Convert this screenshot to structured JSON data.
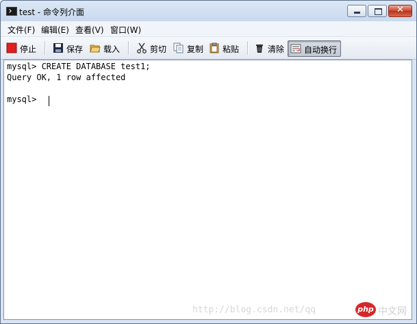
{
  "window": {
    "title": "test - 命令列介面"
  },
  "menu": {
    "items": [
      {
        "label": "文件(F)"
      },
      {
        "label": "编辑(E)"
      },
      {
        "label": "查看(V)"
      },
      {
        "label": "窗口(W)"
      }
    ]
  },
  "toolbar": {
    "stop_label": "停止",
    "save_label": "保存",
    "load_label": "载入",
    "cut_label": "剪切",
    "copy_label": "复制",
    "paste_label": "粘贴",
    "clear_label": "清除",
    "wrap_label": "自动换行"
  },
  "console": {
    "lines": [
      "mysql> CREATE DATABASE test1;",
      "Query OK, 1 row affected",
      "",
      "mysql> "
    ]
  },
  "watermark": {
    "url_text": "http://blog.csdn.net/qq",
    "logo_badge": "php",
    "logo_text": "中文网"
  },
  "colors": {
    "stop": "#e02020",
    "console_bg": "#ffffff",
    "window_chrome": "#d9e4f2"
  }
}
